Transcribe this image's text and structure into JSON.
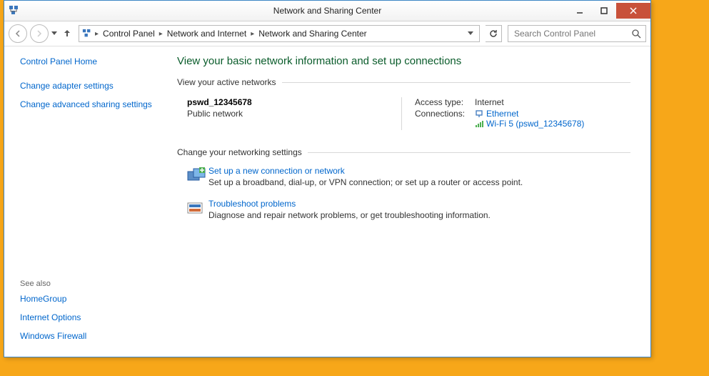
{
  "window": {
    "title": "Network and Sharing Center",
    "close_tooltip": "Close"
  },
  "breadcrumb": {
    "seg1": "Control Panel",
    "seg2": "Network and Internet",
    "seg3": "Network and Sharing Center"
  },
  "search": {
    "placeholder": "Search Control Panel"
  },
  "sidebar": {
    "home": "Control Panel Home",
    "adapter": "Change adapter settings",
    "sharing": "Change advanced sharing settings",
    "see_also": "See also",
    "homegroup": "HomeGroup",
    "internet_options": "Internet Options",
    "firewall": "Windows Firewall"
  },
  "main": {
    "heading": "View your basic network information and set up connections",
    "active_header": "View your active networks",
    "network": {
      "name": "pswd_12345678",
      "type": "Public network",
      "access_label": "Access type:",
      "access_value": "Internet",
      "conn_label": "Connections:",
      "ethernet": "Ethernet",
      "wifi": "Wi-Fi 5 (pswd_12345678)"
    },
    "change_header": "Change your networking settings",
    "task1": {
      "title": "Set up a new connection or network",
      "desc": "Set up a broadband, dial-up, or VPN connection; or set up a router or access point."
    },
    "task2": {
      "title": "Troubleshoot problems",
      "desc": "Diagnose and repair network problems, or get troubleshooting information."
    }
  }
}
